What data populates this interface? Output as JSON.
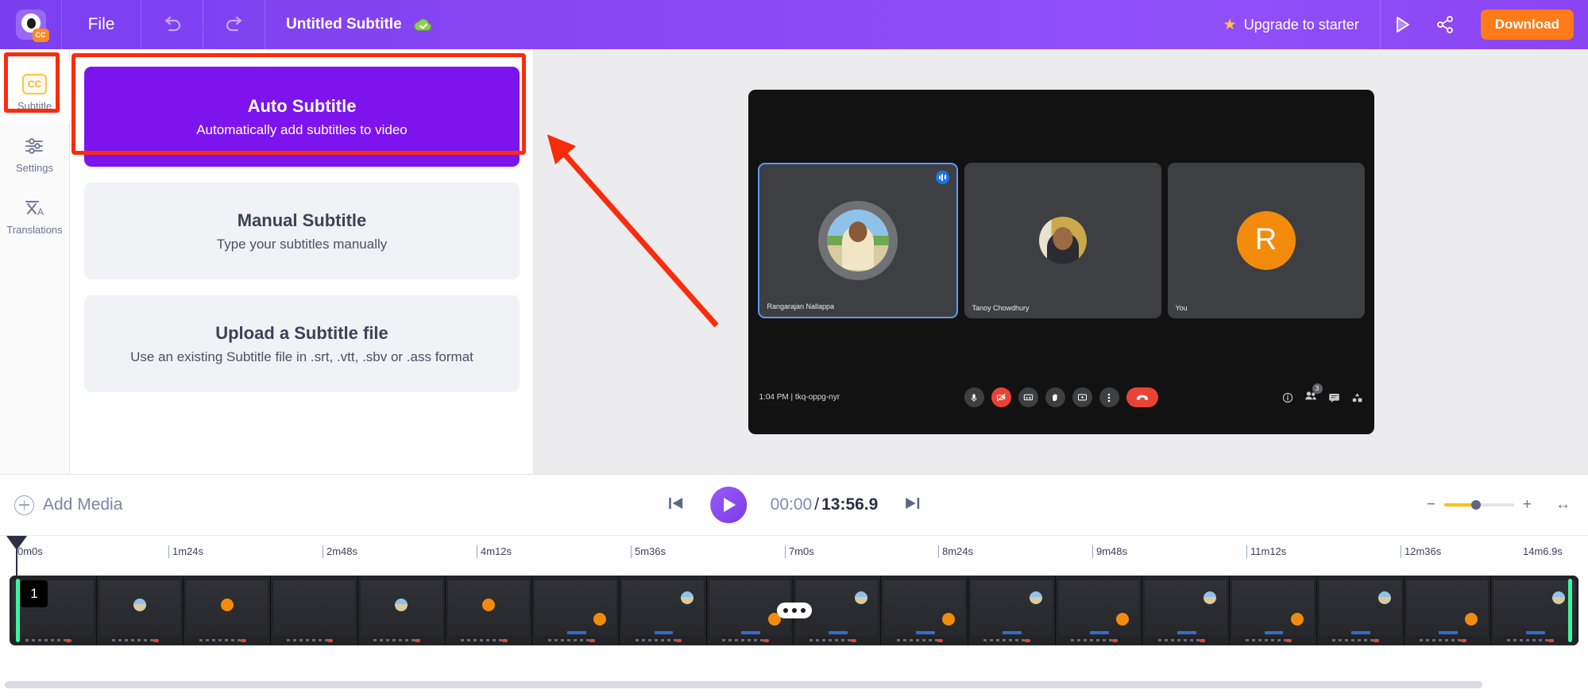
{
  "header": {
    "logo_icon": "app-logo-eye-cc",
    "file_menu": "File",
    "undo_icon": "undo-arrow-icon",
    "redo_icon": "redo-arrow-icon",
    "project_title": "Untitled Subtitle",
    "saved_icon": "cloud-check-icon",
    "upgrade_label": "Upgrade to starter",
    "upgrade_star": "★",
    "preview_icon": "play-preview-icon",
    "share_icon": "share-nodes-icon",
    "download_label": "Download",
    "accent_purple": "#7d14ee",
    "download_orange": "#ff7a18"
  },
  "sidebar": {
    "items": [
      {
        "label": "Subtitle",
        "icon": "cc-icon",
        "active": true
      },
      {
        "label": "Settings",
        "icon": "sliders-icon",
        "active": false
      },
      {
        "label": "Translations",
        "icon": "translate-icon",
        "active": false
      }
    ]
  },
  "panel": {
    "options": [
      {
        "title": "Auto Subtitle",
        "subtitle": "Automatically add subtitles to video",
        "selected": true
      },
      {
        "title": "Manual Subtitle",
        "subtitle": "Type your subtitles manually",
        "selected": false
      },
      {
        "title": "Upload a Subtitle file",
        "subtitle": "Use an existing Subtitle file in .srt, .vtt, .sbv or .ass format",
        "selected": false
      }
    ]
  },
  "annotation": {
    "highlight_color": "#f92c0b",
    "arrow_icon": "red-pointer-arrow"
  },
  "preview": {
    "tiles": [
      {
        "name": "Rangarajan Nallappa",
        "avatar_type": "photo",
        "active": true,
        "mic_icon": "mic-active-icon"
      },
      {
        "name": "Tanoy Chowdhury",
        "avatar_type": "photo",
        "active": false
      },
      {
        "name": "You",
        "avatar_type": "letter",
        "avatar_letter": "R",
        "avatar_color": "#f28b0c",
        "active": false
      }
    ],
    "meeting_time": "1:04 PM",
    "meeting_code": "tkq-oppg-nyr",
    "meeting_separator": "|",
    "controls": [
      {
        "icon": "microphone-icon",
        "state": "on"
      },
      {
        "icon": "camera-off-icon",
        "state": "off"
      },
      {
        "icon": "captions-icon",
        "state": "on"
      },
      {
        "icon": "raise-hand-icon",
        "state": "on"
      },
      {
        "icon": "present-screen-icon",
        "state": "on"
      },
      {
        "icon": "more-options-icon",
        "state": "on"
      },
      {
        "icon": "hang-up-icon",
        "state": "end"
      }
    ],
    "right_controls": [
      {
        "icon": "meeting-details-icon",
        "badge": ""
      },
      {
        "icon": "people-icon",
        "badge": "3"
      },
      {
        "icon": "chat-icon",
        "badge": ""
      },
      {
        "icon": "activities-icon",
        "badge": ""
      }
    ]
  },
  "transport": {
    "add_media_label": "Add Media",
    "add_media_icon": "plus-circle-icon",
    "skip_back_icon": "skip-to-start-icon",
    "play_icon": "play-icon",
    "skip_forward_icon": "skip-to-end-icon",
    "current_time": "00:00",
    "time_separator": "/",
    "total_time": "13:56.9",
    "zoom_out_icon": "minus-icon",
    "zoom_in_icon": "plus-icon",
    "zoom_level_percent": 46,
    "fit_icon": "fit-to-width-icon"
  },
  "timeline": {
    "ticks": [
      "0m0s",
      "1m24s",
      "2m48s",
      "4m12s",
      "5m36s",
      "7m0s",
      "8m24s",
      "9m48s",
      "11m12s",
      "12m36s",
      "14m6.9s"
    ],
    "clip_index_label": "1",
    "playhead_position": "0m0s",
    "trim_handle_color": "#3ef2a1",
    "drag_handle_icon": "three-dots-drag-handle",
    "thumbnail_count": 18
  }
}
